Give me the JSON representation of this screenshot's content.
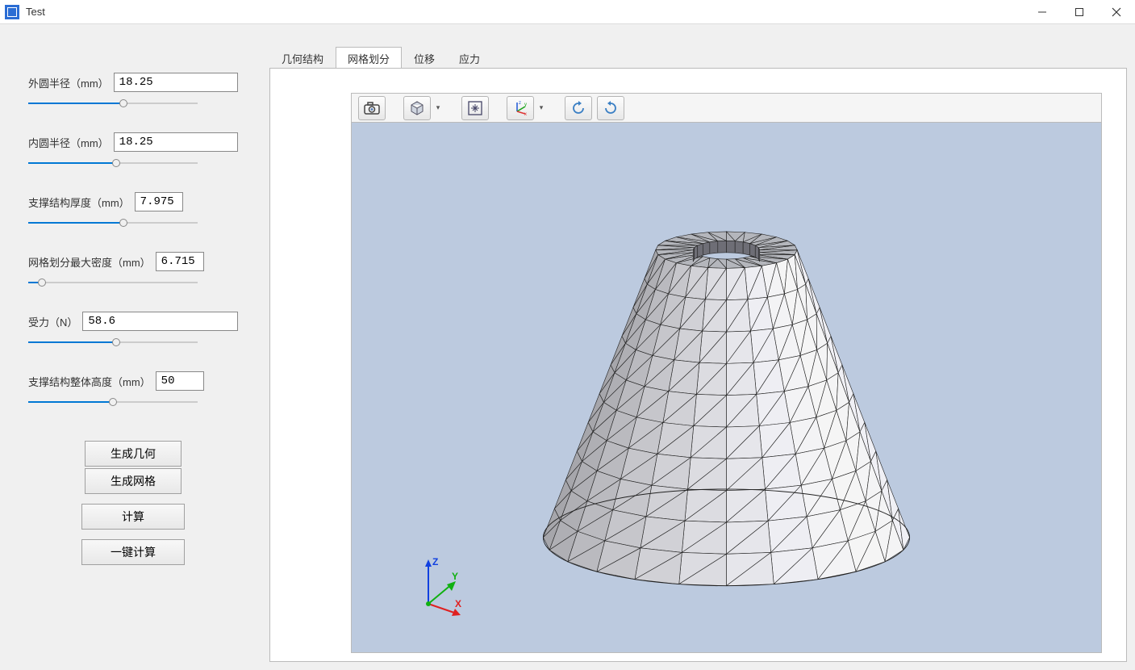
{
  "window": {
    "title": "Test"
  },
  "params": [
    {
      "label": "外圆半径（mm）",
      "value": "18.25",
      "slider_pct": 56
    },
    {
      "label": "内圆半径（mm）",
      "value": "18.25",
      "slider_pct": 52
    },
    {
      "label": "支撑结构厚度（mm）",
      "value": "7.975",
      "slider_pct": 56,
      "narrow": true
    },
    {
      "label": "网格划分最大密度（mm）",
      "value": "6.715",
      "slider_pct": 8,
      "narrow": true
    },
    {
      "label": "受力（N）",
      "value": "58.6",
      "slider_pct": 52
    },
    {
      "label": "支撑结构整体高度（mm）",
      "value": "50",
      "slider_pct": 50,
      "narrow": true
    }
  ],
  "buttons": {
    "gen_geom": "生成几何",
    "gen_mesh": "生成网格",
    "compute": "计算",
    "one_click": "一键计算"
  },
  "tabs": [
    {
      "label": "几何结构",
      "active": false
    },
    {
      "label": "网格划分",
      "active": true
    },
    {
      "label": "位移",
      "active": false
    },
    {
      "label": "应力",
      "active": false
    }
  ],
  "toolbar_icons": [
    "camera-icon",
    "cube-icon",
    "fit-icon",
    "axes-icon",
    "rotate-ccw-icon",
    "rotate-cw-icon"
  ],
  "axes": {
    "x": "X",
    "y": "Y",
    "z": "Z"
  }
}
